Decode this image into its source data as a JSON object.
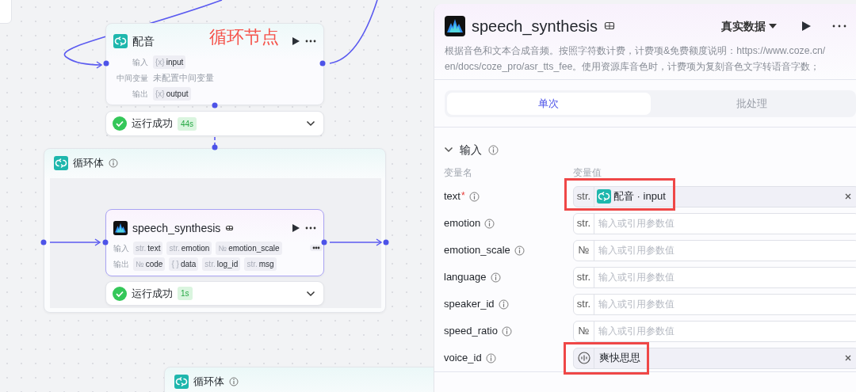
{
  "canvas": {
    "annotation": "循环节点",
    "dub_node": {
      "title": "配音",
      "rows": [
        {
          "label": "输入",
          "kind": "tag",
          "type": "{x}",
          "value": "input"
        },
        {
          "label": "中间变量",
          "kind": "text",
          "value": "未配置中间变量"
        },
        {
          "label": "输出",
          "kind": "tag",
          "type": "{x}",
          "value": "output"
        }
      ],
      "status": {
        "text": "运行成功",
        "time": "44s"
      }
    },
    "loop_body": {
      "title": "循环体"
    },
    "speech_node": {
      "title": "speech_synthesis",
      "input_label": "输入",
      "inputs": [
        {
          "type": "str.",
          "name": "text"
        },
        {
          "type": "str.",
          "name": "emotion"
        },
        {
          "type": "№",
          "name": "emotion_scale"
        }
      ],
      "output_label": "输出",
      "outputs": [
        {
          "type": "№",
          "name": "code"
        },
        {
          "type": "{ }",
          "name": "data"
        },
        {
          "type": "str.",
          "name": "log_id"
        },
        {
          "type": "str.",
          "name": "msg"
        }
      ],
      "status": {
        "text": "运行成功",
        "time": "1s"
      }
    },
    "loop_body_2": {
      "title": "循环体"
    }
  },
  "panel": {
    "title": "speech_synthesis",
    "mode": "真实数据",
    "description_lines": [
      "根据音色和文本合成音频。按照字符数计费，计费项&免费额度说明：https://www.coze.cn/",
      "en/docs/coze_pro/asr_tts_fee。使用资源库音色时，计费项为复刻音色文字转语音字数；"
    ],
    "tabs": [
      {
        "label": "单次",
        "selected": true
      },
      {
        "label": "批处理",
        "selected": false
      }
    ],
    "section": {
      "title": "输入",
      "expanded": true
    },
    "columns": [
      "变量名",
      "变量值"
    ],
    "params": [
      {
        "name": "text",
        "mark": "*",
        "kind": "ref",
        "type": "str.",
        "value": "配音 · input",
        "clearable": true
      },
      {
        "name": "emotion",
        "kind": "input",
        "type": "str.",
        "placeholder": "输入或引用参数值"
      },
      {
        "name": "emotion_scale",
        "kind": "input",
        "type": "№",
        "placeholder": "输入或引用参数值"
      },
      {
        "name": "language",
        "kind": "input",
        "type": "str.",
        "placeholder": "输入或引用参数值"
      },
      {
        "name": "speaker_id",
        "kind": "input",
        "type": "str.",
        "placeholder": "输入或引用参数值"
      },
      {
        "name": "speed_ratio",
        "kind": "input",
        "type": "№",
        "placeholder": "输入或引用参数值"
      },
      {
        "name": "voice_id",
        "kind": "voice",
        "value": "爽快思思",
        "clearable": true
      }
    ]
  }
}
